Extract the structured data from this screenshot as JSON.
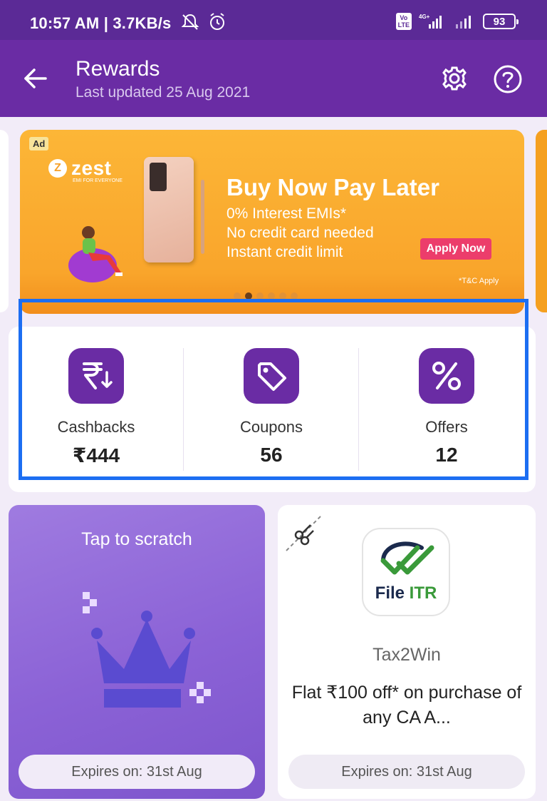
{
  "status_bar": {
    "time": "10:57 AM | 3.7KB/s",
    "network_badge": "4G+",
    "volte_badge": "Vo\nLTE",
    "battery": "93",
    "icons": [
      "mute-icon",
      "alarm-icon",
      "signal-icon",
      "battery-icon"
    ]
  },
  "app_bar": {
    "title": "Rewards",
    "subtitle": "Last updated 25 Aug 2021",
    "icons": [
      "back-arrow-icon",
      "gear-icon",
      "help-icon"
    ]
  },
  "banner": {
    "ad_label": "Ad",
    "brand": "zest",
    "brand_tagline": "EMI FOR EVERYONE",
    "brand_mark": "Z",
    "headline": "Buy Now Pay Later",
    "line1": "0% Interest EMIs*",
    "line2": "No credit card needed",
    "line3": "Instant credit limit",
    "cta": "Apply Now",
    "disclaimer": "*T&C Apply",
    "carousel_total": 6,
    "carousel_active_index": 1
  },
  "summary": {
    "items": [
      {
        "label": "Cashbacks",
        "value": "₹444",
        "icon": "rupee-down-icon"
      },
      {
        "label": "Coupons",
        "value": "56",
        "icon": "tag-icon"
      },
      {
        "label": "Offers",
        "value": "12",
        "icon": "percent-icon"
      }
    ]
  },
  "cards": {
    "scratch": {
      "title": "Tap to scratch",
      "expiry": "Expires on: 31st Aug",
      "icon": "crown-icon"
    },
    "coupon": {
      "logo_text_a": "File ",
      "logo_text_b": "ITR",
      "brand": "Tax2Win",
      "description": "Flat ₹100 off* on purchase of any CA A...",
      "expiry": "Expires on: 31st Aug",
      "icon": "scissors-icon"
    }
  },
  "colors": {
    "header_purple": "#6a2ca4",
    "status_purple": "#5b2a96",
    "banner_orange": "#fcb637",
    "highlight_blue": "#1c6ef2",
    "scratch_purple": "#8b62d6"
  }
}
